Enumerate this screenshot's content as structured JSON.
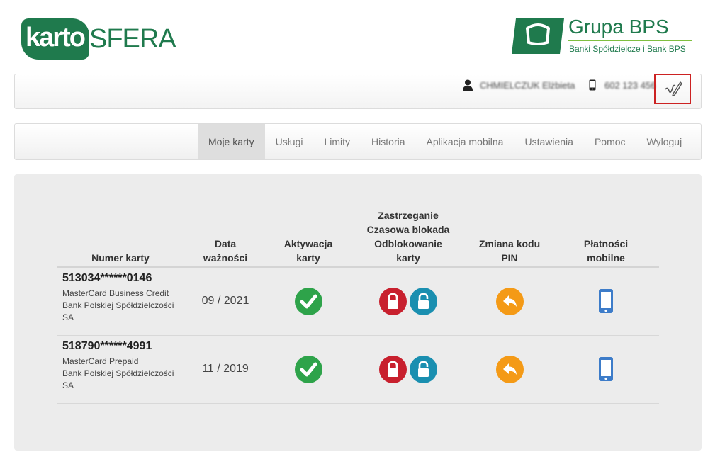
{
  "logos": {
    "left_part1": "karto",
    "left_part2": "SFERA",
    "right_title": "Grupa BPS",
    "right_subtitle": "Banki Spółdzielcze i Bank BPS"
  },
  "userbar": {
    "name": "CHMIELCZUK Elżbieta",
    "phone": "602 123 456"
  },
  "nav": {
    "items": [
      "Moje karty",
      "Usługi",
      "Limity",
      "Historia",
      "Aplikacja mobilna",
      "Ustawienia",
      "Pomoc",
      "Wyloguj"
    ],
    "active": "Moje karty"
  },
  "table": {
    "headers": {
      "card_number": "Numer karty",
      "validity": "Data\nważności",
      "activation": "Aktywacja\nkarty",
      "block": "Zastrzeganie\nCzasowa blokada\nOdblokowanie\nkarty",
      "pin": "Zmiana kodu\nPIN",
      "mobile": "Płatności\nmobilne"
    },
    "rows": [
      {
        "number": "513034******0146",
        "desc": "MasterCard Business Credit\nBank Polskiej Spółdzielczości\nSA",
        "validity": "09 / 2021"
      },
      {
        "number": "518790******4991",
        "desc": "MasterCard Prepaid\nBank Polskiej Spółdzielczości\nSA",
        "validity": "11 / 2019"
      }
    ]
  },
  "colors": {
    "brand_green": "#1f7a4d",
    "accent_lime": "#7fbf3f",
    "ok_green": "#2ea34a",
    "lock_red": "#c8202e",
    "unlock_teal": "#1a8fb0",
    "pin_orange": "#f49a16",
    "phone_blue": "#3d7cc9",
    "highlight_red": "#cc2222"
  },
  "icons": [
    "person-icon",
    "phone-icon",
    "edit-signature-icon",
    "check-icon",
    "lock-closed-icon",
    "lock-open-icon",
    "reply-arrow-icon",
    "smartphone-icon"
  ]
}
